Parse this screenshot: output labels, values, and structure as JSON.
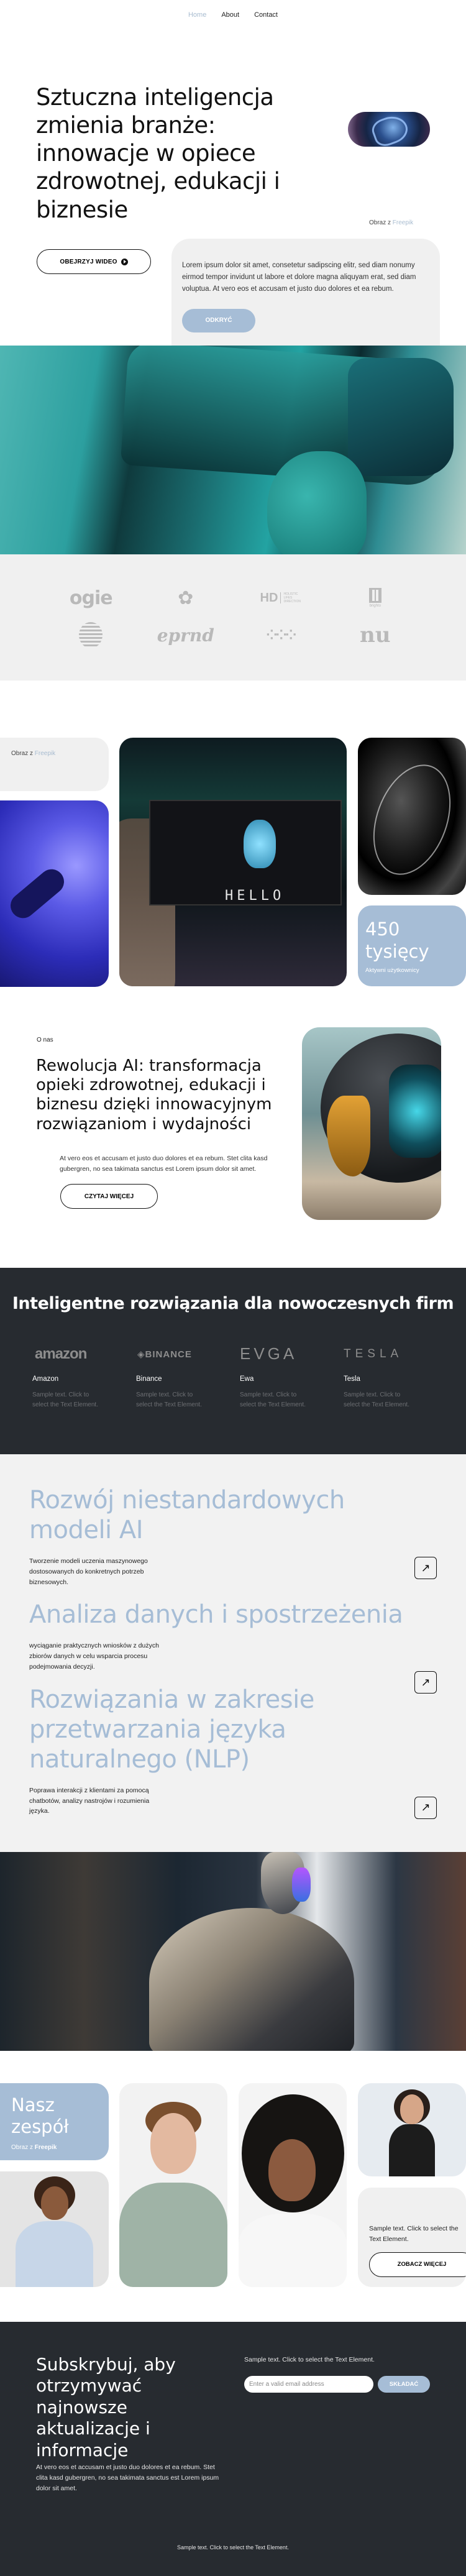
{
  "nav": {
    "items": [
      {
        "label": "Home",
        "active": true
      },
      {
        "label": "About",
        "active": false
      },
      {
        "label": "Contact",
        "active": false
      }
    ]
  },
  "hero": {
    "title": "Sztuczna inteligencja zmienia branże: innowacje w opiece zdrowotnej, edukacji i biznesie",
    "credit_prefix": "Obraz z",
    "credit_link": "Freepik",
    "watch_video_label": "OBEJRZYJ WIDEO",
    "card_text": "Lorem ipsum dolor sit amet, consetetur sadipscing elitr, sed diam nonumy eirmod tempor invidunt ut labore et dolore magna aliquyam erat, sed diam voluptua. At vero eos et accusam et justo duo dolores et ea rebum.",
    "discover_label": "ODKRYĆ"
  },
  "logos": [
    "ogie",
    "flower-mark",
    "HD Holistic Lifes Direction",
    "brighto",
    "striped-globe",
    "eprnd",
    "dots-mark",
    "nu"
  ],
  "logo_hd": {
    "mark": "HD",
    "lines": [
      "HOLISTIC",
      "LIFES",
      "DIRECTION"
    ]
  },
  "logo_brighto": "brighto",
  "logo_ogie": "ogie",
  "logo_eprnd": "eprnd",
  "logo_nu": "nu",
  "gallery": {
    "credit_prefix": "Obraz z",
    "credit_link": "Freepik",
    "monitor_text": "HELLO",
    "stat_value": "450 tysięcy",
    "stat_label": "Aktywni użytkownicy"
  },
  "about": {
    "eyebrow": "O nas",
    "title": "Rewolucja AI: transformacja opieki zdrowotnej, edukacji i biznesu dzięki innowacyjnym rozwiązaniom i wydajności",
    "text": "At vero eos et accusam et justo duo dolores et ea rebum. Stet clita kasd gubergren, no sea takimata sanctus est Lorem ipsum dolor sit amet.",
    "read_more_label": "CZYTAJ WIĘCEJ"
  },
  "firms": {
    "title": "Inteligentne rozwiązania dla nowoczesnych firm",
    "items": [
      {
        "logo": "amazon",
        "name": "Amazon",
        "desc": "Sample text. Click to select the Text Element."
      },
      {
        "logo": "◈BINANCE",
        "name": "Binance",
        "desc": "Sample text. Click to select the Text Element."
      },
      {
        "logo": "EVGA",
        "name": "Ewa",
        "desc": "Sample text. Click to select the Text Element."
      },
      {
        "logo": "TESLA",
        "name": "Tesla",
        "desc": "Sample text. Click to select the Text Element."
      }
    ]
  },
  "services": [
    {
      "title": "Rozwój niestandardowych modeli AI",
      "text": "Tworzenie modeli uczenia maszynowego dostosowanych do konkretnych potrzeb biznesowych.",
      "icon": "arrow-up-right-icon"
    },
    {
      "title": "Analiza danych i spostrzeżenia",
      "text": "wyciąganie praktycznych wniosków z dużych zbiorów danych w celu wsparcia procesu podejmowania decyzji.",
      "icon": "arrow-up-right-icon"
    },
    {
      "title": "Rozwiązania w zakresie przetwarzania języka naturalnego (NLP)",
      "text": "Poprawa interakcji z klientami za pomocą chatbotów, analizy nastrojów i rozumienia języka.",
      "icon": "arrow-up-right-icon"
    }
  ],
  "team": {
    "title": "Nasz zespół",
    "credit_prefix": "Obraz z",
    "credit_link": "Freepik",
    "cta_text": "Sample text. Click to select the Text Element.",
    "see_more_label": "ZOBACZ WIĘCEJ"
  },
  "subscribe": {
    "title": "Subskrybuj, aby otrzymywać najnowsze aktualizacje i informacje",
    "text": "At vero eos et accusam et justo duo dolores et ea rebum. Stet clita kasd gubergren, no sea takimata sanctus est Lorem ipsum dolor sit amet.",
    "hint": "Sample text. Click to select the Text Element.",
    "email_value": "",
    "email_placeholder": "Enter a valid email address",
    "submit_label": "SKŁADAĆ",
    "footer_text": "Sample text. Click to select the Text Element."
  },
  "colors": {
    "accent": "#a6bdd6",
    "dark_bg": "#272b30",
    "light_bg": "#f0f0f0",
    "nav_active": "#a8bcd0"
  }
}
